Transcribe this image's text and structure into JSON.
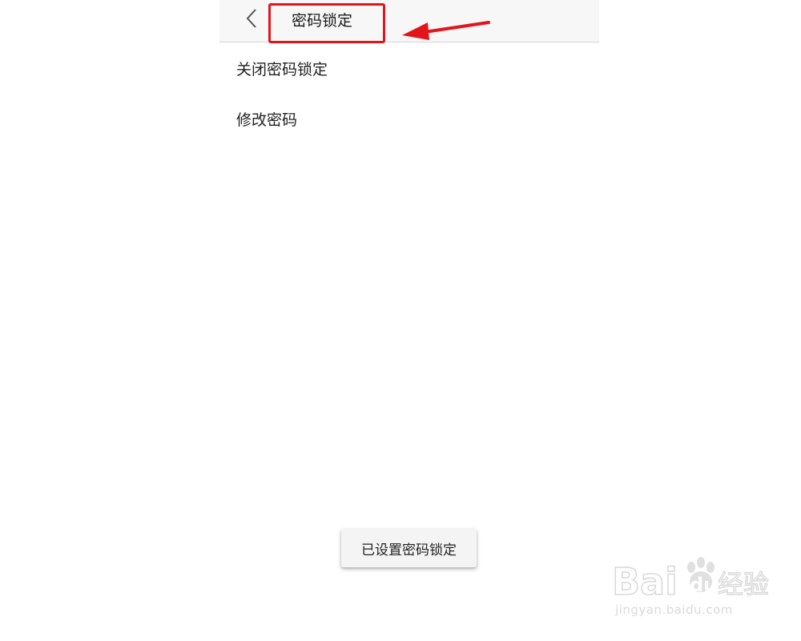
{
  "header": {
    "back_icon": "chevron-left-icon",
    "title": "密码锁定"
  },
  "menu": {
    "items": [
      {
        "label": "关闭密码锁定"
      },
      {
        "label": "修改密码"
      }
    ]
  },
  "toast": {
    "message": "已设置密码锁定"
  },
  "annotation": {
    "color": "#e3141b"
  },
  "watermark": {
    "brand_text": "Baidu经验",
    "url": "jingyan.baidu.com"
  }
}
